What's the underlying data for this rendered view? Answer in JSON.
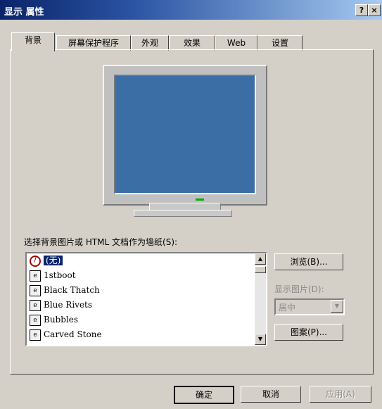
{
  "window": {
    "title": "显示 属性",
    "help_label": "?",
    "close_label": "×"
  },
  "tabs": [
    {
      "label": "背景",
      "active": true
    },
    {
      "label": "屏幕保护程序"
    },
    {
      "label": "外观"
    },
    {
      "label": "效果"
    },
    {
      "label": "Web"
    },
    {
      "label": "设置"
    }
  ],
  "wallpaper": {
    "label": "选择背景图片或 HTML 文档作为墙纸(S):",
    "items": [
      {
        "label": "(无)",
        "selected": true,
        "icon": "none-icon"
      },
      {
        "label": "1stboot",
        "icon": "html-doc-icon"
      },
      {
        "label": "Black Thatch",
        "icon": "html-doc-icon"
      },
      {
        "label": "Blue Rivets",
        "icon": "html-doc-icon"
      },
      {
        "label": "Bubbles",
        "icon": "html-doc-icon"
      },
      {
        "label": "Carved Stone",
        "icon": "html-doc-icon"
      }
    ]
  },
  "side": {
    "browse_label": "浏览(B)...",
    "display_label": "显示图片(D):",
    "display_value": "居中",
    "pattern_label": "图案(P)..."
  },
  "footer": {
    "ok_label": "确定",
    "cancel_label": "取消",
    "apply_label": "应用(A)"
  },
  "colors": {
    "desktop": "#3a6ea5",
    "selection": "#0a246a",
    "face": "#d4d0c8"
  }
}
